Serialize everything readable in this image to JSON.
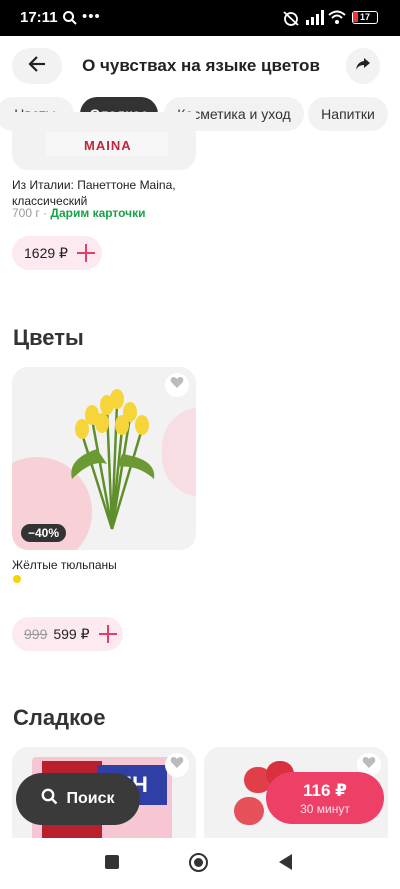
{
  "status_bar": {
    "time": "17:11",
    "battery": "17"
  },
  "header": {
    "title": "О чувствах на языке цветов"
  },
  "tabs": [
    {
      "label": "Цветы",
      "active": false
    },
    {
      "label": "Сладкое",
      "active": true
    },
    {
      "label": "Косметика и уход",
      "active": false
    },
    {
      "label": "Напитки",
      "active": false
    }
  ],
  "top_product": {
    "brand_text": "MAINA",
    "name": "Из Италии: Панеттоне Maina, классический",
    "weight": "700 г",
    "promo": "Дарим карточки",
    "price": "1629 ₽"
  },
  "flowers_section": {
    "title": "Цветы",
    "product": {
      "discount": "−40%",
      "name": "Жёлтые тюльпаны",
      "old_price": "999",
      "price": "599 ₽",
      "dot_color": "#f5d400"
    }
  },
  "sweets_section": {
    "title": "Сладкое",
    "card_text": "ПН"
  },
  "search_button": {
    "label": "Поиск"
  },
  "cart_button": {
    "price": "116 ₽",
    "delivery": "30 минут"
  },
  "colors": {
    "accent": "#ee3f67",
    "dark": "#333333",
    "pill_bg": "#fdeaf0"
  }
}
